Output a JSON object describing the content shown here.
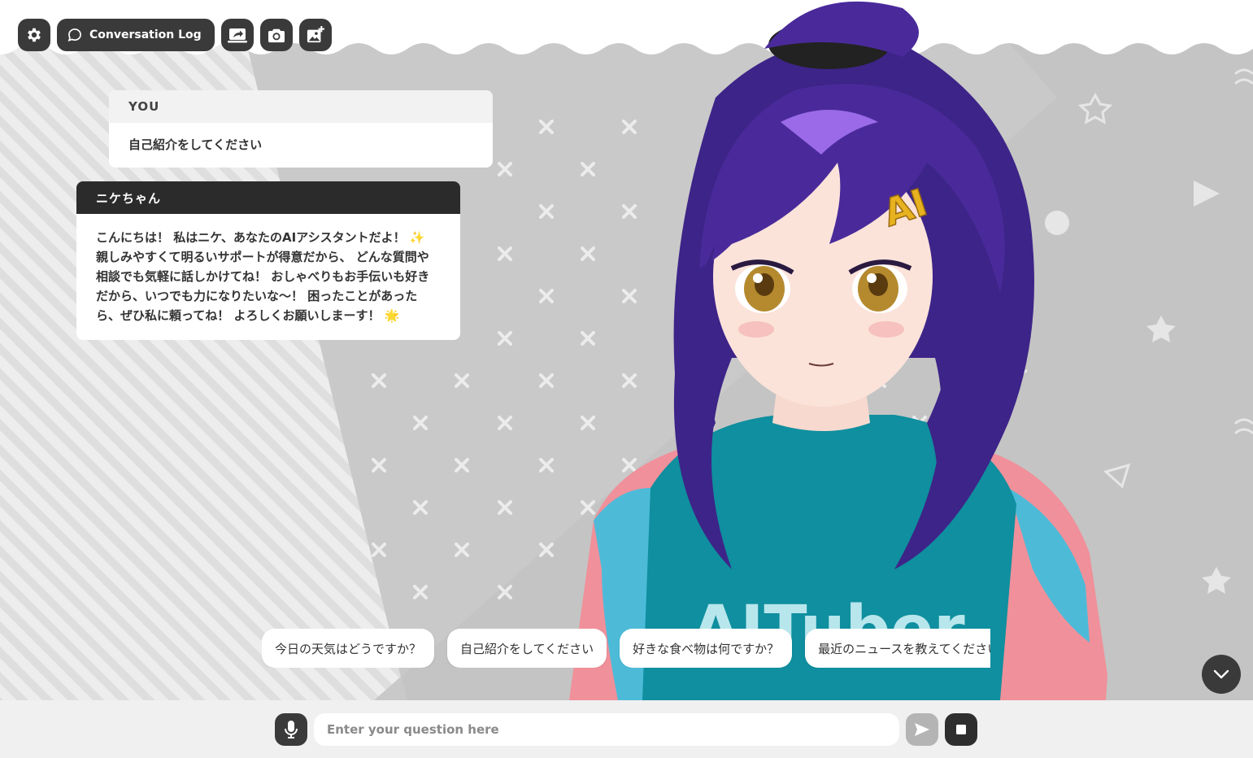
{
  "toolbar": {
    "settings_icon": "gear-icon",
    "log_label": "Conversation Log",
    "share_icon": "share-screen-icon",
    "camera_icon": "camera-icon",
    "image_add_icon": "image-add-icon"
  },
  "messages": [
    {
      "role_label": "YOU",
      "text": "自己紹介をしてください"
    },
    {
      "role_label": "ニケちゃん",
      "text": "こんにちは！ 私はニケ、あなたのAIアシスタントだよ！ ✨ 親しみやすくて明るいサポートが得意だから、 どんな質問や相談でも気軽に話しかけてね！ おしゃべりもお手伝いも好きだから、いつでも力になりたいな〜！ 困ったことがあったら、ぜひ私に頼ってね！ よろしくお願いしまーす！ 🌟"
    }
  ],
  "character": {
    "hairclip_text": "AI",
    "shirt_text": "AITuber"
  },
  "suggestions": [
    "今日の天気はどうですか？",
    "自己紹介をしてください",
    "好きな食べ物は何ですか？",
    "最近のニュースを教えてください"
  ],
  "input": {
    "placeholder": "Enter your question here",
    "value": ""
  },
  "colors": {
    "dark_button": "#3a3a3a",
    "hair": "#4a2a9a",
    "shirt": "#0f8f9f",
    "jacket_pink": "#f0909a",
    "jacket_blue": "#4dbbd8"
  }
}
